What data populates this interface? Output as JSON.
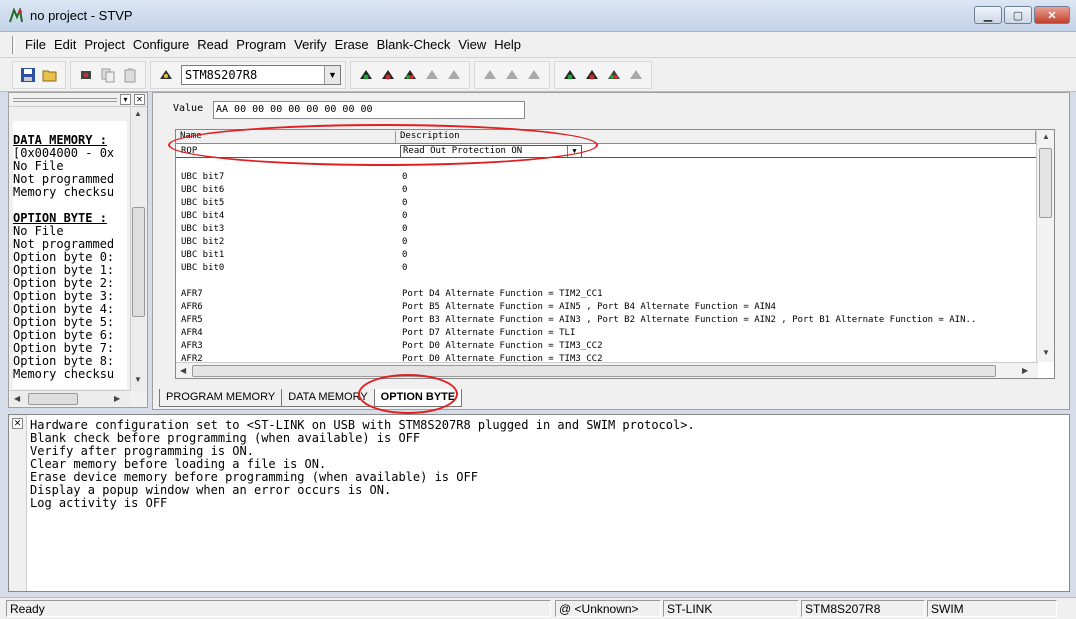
{
  "window": {
    "title": "no project - STVP"
  },
  "menu": [
    "File",
    "Edit",
    "Project",
    "Configure",
    "Read",
    "Program",
    "Verify",
    "Erase",
    "Blank-Check",
    "View",
    "Help"
  ],
  "toolbar": {
    "device": "STM8S207R8"
  },
  "left_panel": {
    "lines": [
      "",
      "DATA MEMORY :",
      "[0x004000 - 0x",
      "No File",
      "Not programmed",
      "Memory checksu",
      "",
      "OPTION BYTE :",
      "No File",
      "Not programmed",
      "Option byte 0:",
      "Option byte 1:",
      "Option byte 2:",
      "Option byte 3:",
      "Option byte 4:",
      "Option byte 5:",
      "Option byte 6:",
      "Option byte 7:",
      "Option byte 8:",
      "Memory checksu"
    ]
  },
  "option_byte": {
    "value_label": "Value",
    "value": "AA 00 00 00 00 00 00 00 00",
    "columns": [
      "Name",
      "Description"
    ],
    "rop": {
      "name": "ROP",
      "description": "Read Out Protection ON"
    },
    "rows": [
      {
        "name": "UBC bit7",
        "desc": "0"
      },
      {
        "name": "UBC bit6",
        "desc": "0"
      },
      {
        "name": "UBC bit5",
        "desc": "0"
      },
      {
        "name": "UBC bit4",
        "desc": "0"
      },
      {
        "name": "UBC bit3",
        "desc": "0"
      },
      {
        "name": "UBC bit2",
        "desc": "0"
      },
      {
        "name": "UBC bit1",
        "desc": "0"
      },
      {
        "name": "UBC bit0",
        "desc": "0"
      },
      {
        "name": "",
        "desc": ""
      },
      {
        "name": "AFR7",
        "desc": "Port D4 Alternate Function = TIM2_CC1"
      },
      {
        "name": "AFR6",
        "desc": "Port B5 Alternate Function = AIN5 , Port B4 Alternate Function = AIN4"
      },
      {
        "name": "AFR5",
        "desc": "Port B3 Alternate Function = AIN3 , Port B2 Alternate Function = AIN2 , Port B1 Alternate Function = AIN.."
      },
      {
        "name": "AFR4",
        "desc": "Port D7 Alternate Function = TLI"
      },
      {
        "name": "AFR3",
        "desc": "Port D0 Alternate Function = TIM3_CC2"
      },
      {
        "name": "AFR2",
        "desc": "Port D0 Alternate Function = TIM3_CC2"
      }
    ]
  },
  "tabs": [
    "PROGRAM MEMORY",
    "DATA MEMORY",
    "OPTION BYTE"
  ],
  "active_tab": "OPTION BYTE",
  "log": [
    "Hardware configuration set to <ST-LINK on USB with STM8S207R8 plugged in and SWIM protocol>.",
    "Blank check before programming (when available) is OFF",
    "Verify after programming is ON.",
    "Clear memory before loading a file is ON.",
    "Erase device memory before programming (when available) is OFF",
    "Display a popup window when an error occurs is ON.",
    "Log activity is OFF"
  ],
  "status": {
    "ready": "Ready",
    "port": "@ <Unknown>",
    "probe": "ST-LINK",
    "device": "STM8S207R8",
    "protocol": "SWIM"
  },
  "colors": {
    "annotation": "#e02020"
  }
}
